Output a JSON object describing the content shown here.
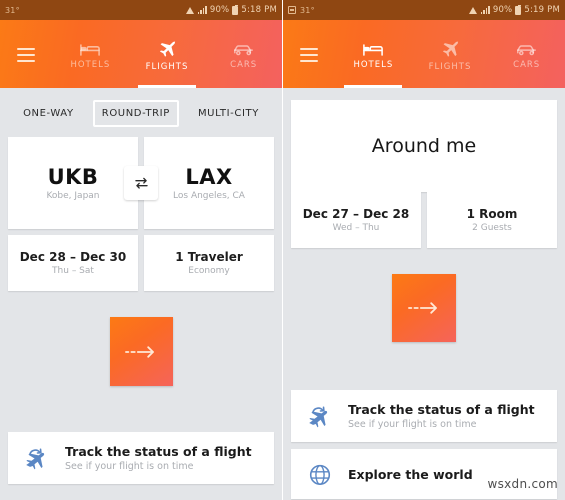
{
  "left": {
    "statusbar": {
      "temperature": "31°",
      "wifi_icon": "wifi-icon",
      "signal_icon": "signal-icon",
      "battery_percent": "90%",
      "battery_icon": "battery-charging-icon",
      "clock": "5:18 PM"
    },
    "appbar": {
      "menu_icon": "hamburger-menu-icon",
      "tabs": [
        {
          "label": "HOTELS",
          "icon": "bed-icon",
          "active": false
        },
        {
          "label": "FLIGHTS",
          "icon": "plane-icon",
          "active": true
        },
        {
          "label": "CARS",
          "icon": "car-icon",
          "active": false
        }
      ]
    },
    "trip_types": [
      {
        "label": "ONE-WAY",
        "selected": false
      },
      {
        "label": "ROUND-TRIP",
        "selected": true
      },
      {
        "label": "MULTI-CITY",
        "selected": false
      }
    ],
    "origin": {
      "code": "UKB",
      "city": "Kobe, Japan"
    },
    "destination": {
      "code": "LAX",
      "city": "Los Angeles, CA"
    },
    "swap_icon": "swap-arrows-icon",
    "dates": {
      "main": "Dec 28 – Dec 30",
      "sub": "Thu – Sat"
    },
    "travelers": {
      "main": "1 Traveler",
      "sub": "Economy"
    },
    "search_button": {
      "icon": "dashed-arrow-right-icon"
    },
    "promos": [
      {
        "icon": "flight-status-icon",
        "title": "Track the status of a flight",
        "subtitle": "See if your flight is on time"
      }
    ]
  },
  "right": {
    "statusbar": {
      "screenshot_icon": "screenshot-icon",
      "temperature": "31°",
      "wifi_icon": "wifi-icon",
      "signal_icon": "signal-icon",
      "battery_percent": "90%",
      "battery_icon": "battery-charging-icon",
      "clock": "5:19 PM"
    },
    "appbar": {
      "menu_icon": "hamburger-menu-icon",
      "tabs": [
        {
          "label": "HOTELS",
          "icon": "bed-icon",
          "active": true
        },
        {
          "label": "FLIGHTS",
          "icon": "plane-icon",
          "active": false
        },
        {
          "label": "CARS",
          "icon": "car-icon",
          "active": false
        }
      ]
    },
    "location": {
      "label": "Around me"
    },
    "dates": {
      "main": "Dec 27 – Dec 28",
      "sub": "Wed – Thu"
    },
    "rooms": {
      "main": "1 Room",
      "sub": "2 Guests"
    },
    "search_button": {
      "icon": "dashed-arrow-right-icon"
    },
    "promos": [
      {
        "icon": "flight-status-icon",
        "title": "Track the status of a flight",
        "subtitle": "See if your flight is on time"
      },
      {
        "icon": "globe-icon",
        "title": "Explore the world",
        "subtitle": ""
      }
    ]
  },
  "watermark": "wsxdn.com",
  "colors": {
    "gradient_start": "#FB7A16",
    "gradient_end": "#F4615F",
    "statusbar_bg": "#8F4712",
    "page_bg": "#E3E5E8",
    "promo_icon": "#5B87C4"
  }
}
